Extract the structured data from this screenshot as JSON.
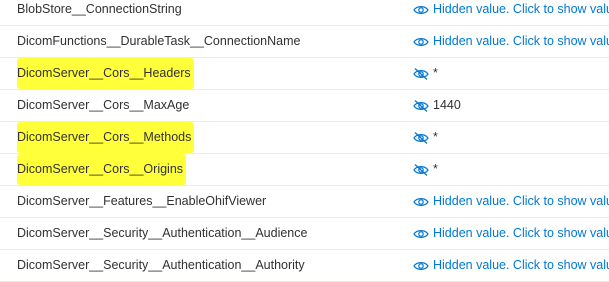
{
  "settings": [
    {
      "name": "BlobStore__ConnectionString",
      "value": "Hidden value. Click to show value",
      "mode": "hidden",
      "highlighted": false
    },
    {
      "name": "DicomFunctions__DurableTask__ConnectionName",
      "value": "Hidden value. Click to show value",
      "mode": "hidden",
      "highlighted": false
    },
    {
      "name": "DicomServer__Cors__Headers",
      "value": "*",
      "mode": "visible",
      "highlighted": true
    },
    {
      "name": "DicomServer__Cors__MaxAge",
      "value": "1440",
      "mode": "visible",
      "highlighted": false
    },
    {
      "name": "DicomServer__Cors__Methods",
      "value": "*",
      "mode": "visible",
      "highlighted": true
    },
    {
      "name": "DicomServer__Cors__Origins",
      "value": "*",
      "mode": "visible",
      "highlighted": true
    },
    {
      "name": "DicomServer__Features__EnableOhifViewer",
      "value": "Hidden value. Click to show value",
      "mode": "hidden",
      "highlighted": false
    },
    {
      "name": "DicomServer__Security__Authentication__Audience",
      "value": "Hidden value. Click to show value",
      "mode": "hidden",
      "highlighted": false
    },
    {
      "name": "DicomServer__Security__Authentication__Authority",
      "value": "Hidden value. Click to show value",
      "mode": "hidden",
      "highlighted": false
    }
  ],
  "icons": {
    "hidden": "eye-icon",
    "visible": "eye-slash-icon"
  },
  "colors": {
    "link": "#0078d4",
    "highlight": "#ffff3a",
    "text": "#323130"
  }
}
